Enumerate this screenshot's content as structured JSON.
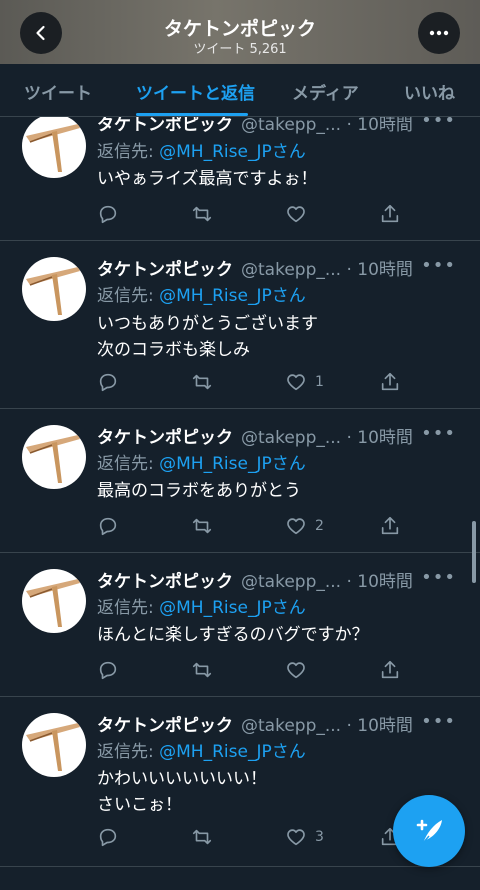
{
  "header": {
    "title": "タケトンポピック",
    "tweet_count": "ツイート 5,261",
    "back_icon": "chevron-left-icon",
    "more_icon": "more-horizontal-icon"
  },
  "tabs": [
    {
      "label": "ツイート",
      "active": false
    },
    {
      "label": "ツイートと返信",
      "active": true
    },
    {
      "label": "メディア",
      "active": false
    },
    {
      "label": "いいね",
      "active": false
    }
  ],
  "tweets": [
    {
      "name": "タケトンポピック",
      "handle": "@takepp_...",
      "time": "· 10時間",
      "reply_prefix": "返信先: ",
      "reply_to": "@MH_Rise_JPさん",
      "lines": [
        "いやぁライズ最高ですよぉ！"
      ],
      "likes": ""
    },
    {
      "name": "タケトンポピック",
      "handle": "@takepp_...",
      "time": "· 10時間",
      "reply_prefix": "返信先: ",
      "reply_to": "@MH_Rise_JPさん",
      "lines": [
        "いつもありがとうございます",
        "次のコラボも楽しみ"
      ],
      "likes": "1"
    },
    {
      "name": "タケトンポピック",
      "handle": "@takepp_...",
      "time": "· 10時間",
      "reply_prefix": "返信先: ",
      "reply_to": "@MH_Rise_JPさん",
      "lines": [
        "最高のコラボをありがとう"
      ],
      "likes": "2"
    },
    {
      "name": "タケトンポピック",
      "handle": "@takepp_...",
      "time": "· 10時間",
      "reply_prefix": "返信先: ",
      "reply_to": "@MH_Rise_JPさん",
      "lines": [
        "ほんとに楽しすぎるのバグですか？"
      ],
      "likes": ""
    },
    {
      "name": "タケトンポピック",
      "handle": "@takepp_...",
      "time": "· 10時間",
      "reply_prefix": "返信先: ",
      "reply_to": "@MH_Rise_JPさん",
      "lines": [
        "かわいいいいいいい！",
        "さいこぉ！"
      ],
      "likes": "3"
    }
  ],
  "fab": {
    "icon": "compose-tweet-icon"
  },
  "colors": {
    "background": "#15202b",
    "accent": "#1da1f2",
    "muted": "#8899a6",
    "divider": "#38444d"
  }
}
